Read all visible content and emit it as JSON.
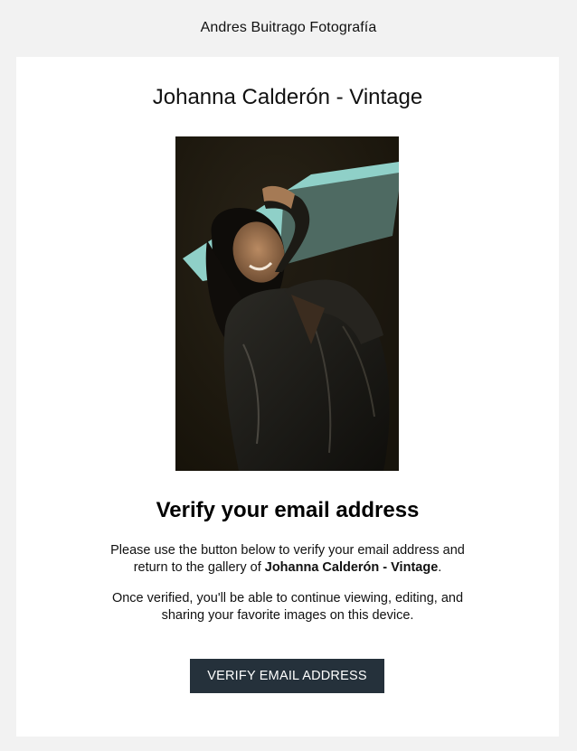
{
  "header": {
    "brand_name": "Andres Buitrago Fotografía"
  },
  "email": {
    "gallery_title": "Johanna Calderón - Vintage",
    "heading": "Verify your email address",
    "paragraph1_prefix": "Please use the button below to verify your email address and return to the gallery of ",
    "paragraph1_gallery": "Johanna Calderón - Vintage",
    "paragraph1_suffix": ".",
    "paragraph2": "Once verified, you'll be able to continue viewing, editing, and sharing your favorite images on this device.",
    "button_label": "VERIFY EMAIL ADDRESS"
  },
  "colors": {
    "page_background": "#f2f2f2",
    "card_background": "#ffffff",
    "button_background": "#25313b",
    "button_text": "#ffffff"
  }
}
